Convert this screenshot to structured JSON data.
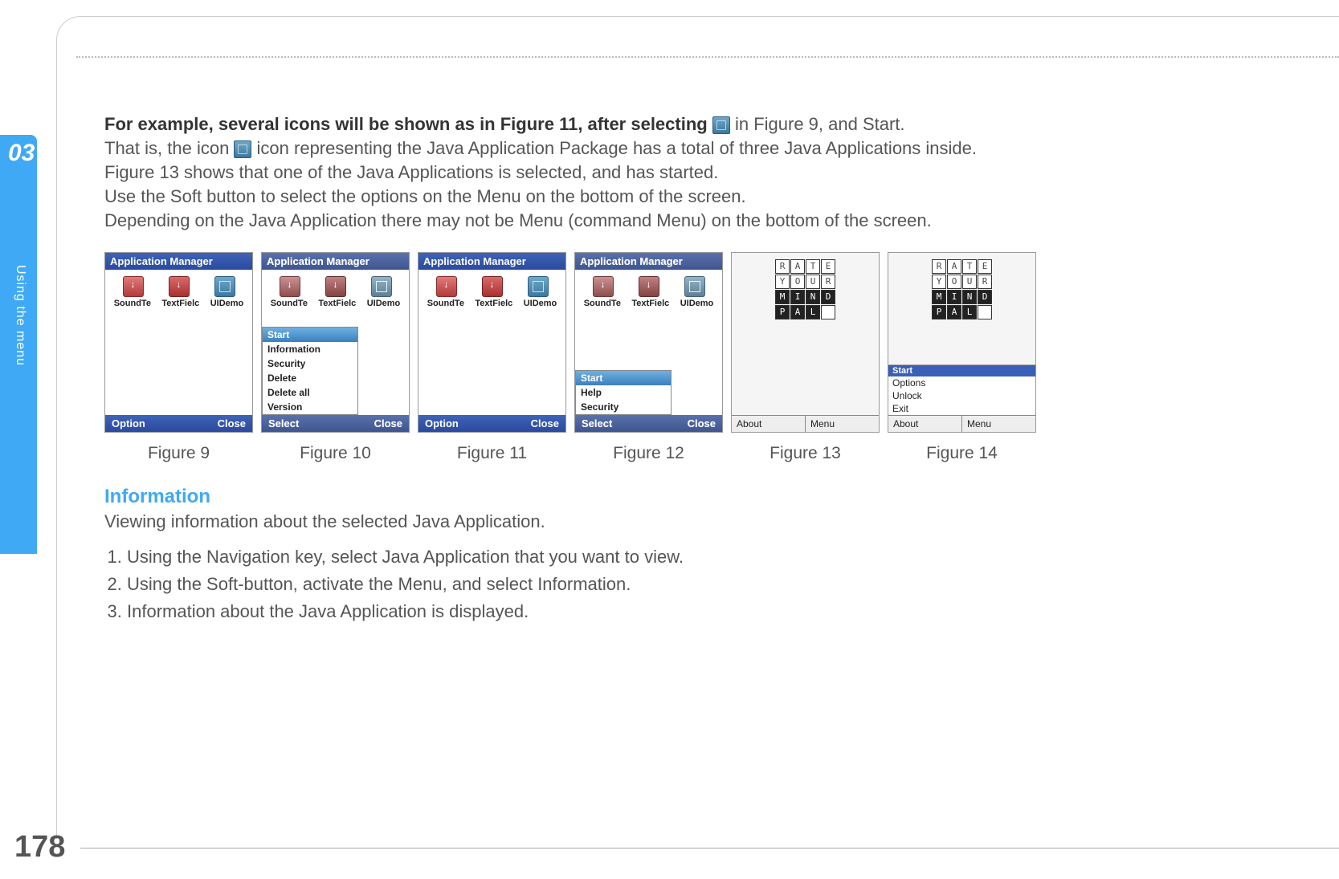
{
  "chapter_number": "03",
  "sidebar_label": "Using the menu",
  "page_number": "178",
  "intro": {
    "bold_lead": "For example, several icons will be shown as in Figure 11, after selecting",
    "after_icon1": " in Figure 9, and Start.",
    "line2_a": "That is, the icon ",
    "line2_b": " icon representing the Java Application Package has a total of three Java Applications inside.",
    "line3": "Figure 13 shows that one of the Java Applications is selected, and has started.",
    "line4": "Use the Soft button to select the options on the Menu on the bottom of the screen.",
    "line5": "Depending on the Java Application there may not be Menu (command Menu) on the bottom of the screen."
  },
  "app_manager_title": "Application  Manager",
  "app_labels": {
    "a": "SoundTe",
    "b": "TextFielc",
    "c": "UIDemo"
  },
  "softkeys": {
    "option": "Option",
    "close": "Close",
    "select": "Select",
    "about": "About",
    "menu": "Menu"
  },
  "fig10_menu": [
    "Start",
    "Information",
    "Security",
    "Delete",
    "Delete  all",
    "Version"
  ],
  "fig12_menu": [
    "Start",
    "Help",
    "Security"
  ],
  "fig14_menu": [
    "Start",
    "Options",
    "Unlock",
    "Exit"
  ],
  "rymp": {
    "r1": [
      "R",
      "A",
      "T",
      "E"
    ],
    "r2": [
      "Y",
      "O",
      "U",
      "R"
    ],
    "r3": [
      "M",
      "I",
      "N",
      "D"
    ],
    "r4": [
      "P",
      "A",
      "L",
      ""
    ]
  },
  "captions": {
    "f9": "Figure 9",
    "f10": "Figure 10",
    "f11": "Figure 11",
    "f12": "Figure 12",
    "f13": "Figure 13",
    "f14": "Figure 14"
  },
  "info_section": {
    "heading": "Information",
    "sub": "Viewing information about the selected Java Application.",
    "step1": "Using the Navigation key, select Java Application that you want to view.",
    "step2": "Using the Soft-button, activate the Menu, and select Information.",
    "step3": "Information about the Java Application is displayed."
  }
}
